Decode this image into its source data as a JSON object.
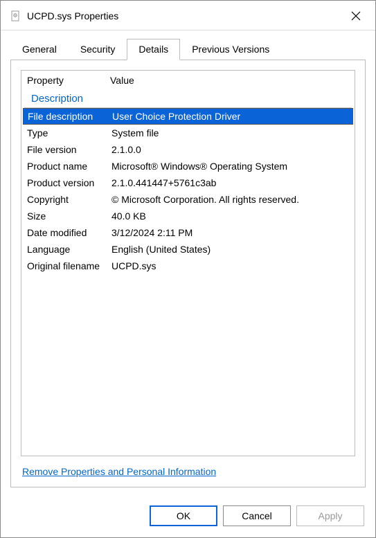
{
  "window": {
    "title": "UCPD.sys Properties"
  },
  "tabs": {
    "general": "General",
    "security": "Security",
    "details": "Details",
    "previous": "Previous Versions"
  },
  "details": {
    "header_property": "Property",
    "header_value": "Value",
    "group": "Description",
    "rows": [
      {
        "prop": "File description",
        "val": "User Choice Protection Driver"
      },
      {
        "prop": "Type",
        "val": "System file"
      },
      {
        "prop": "File version",
        "val": "2.1.0.0"
      },
      {
        "prop": "Product name",
        "val": "Microsoft® Windows® Operating System"
      },
      {
        "prop": "Product version",
        "val": "2.1.0.441447+5761c3ab"
      },
      {
        "prop": "Copyright",
        "val": "© Microsoft Corporation. All rights reserved."
      },
      {
        "prop": "Size",
        "val": "40.0 KB"
      },
      {
        "prop": "Date modified",
        "val": "3/12/2024 2:11 PM"
      },
      {
        "prop": "Language",
        "val": "English (United States)"
      },
      {
        "prop": "Original filename",
        "val": "UCPD.sys"
      }
    ],
    "link": "Remove Properties and Personal Information"
  },
  "buttons": {
    "ok": "OK",
    "cancel": "Cancel",
    "apply": "Apply"
  }
}
